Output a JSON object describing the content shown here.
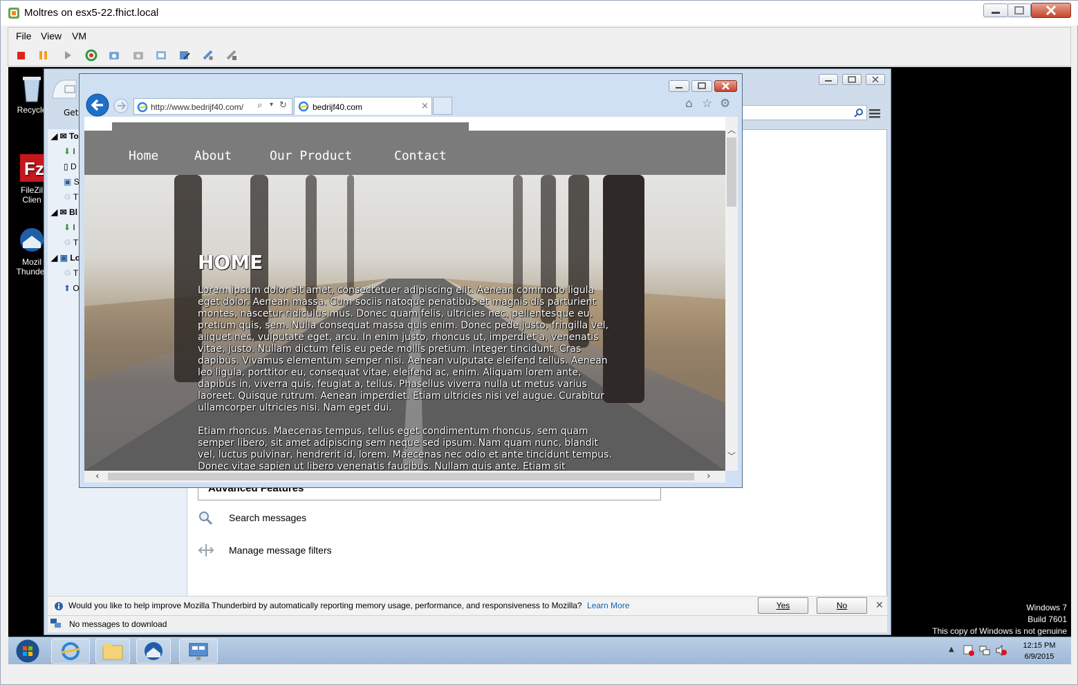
{
  "outer_window": {
    "title": "Moltres on esx5-22.fhict.local",
    "menu": [
      "File",
      "View",
      "VM"
    ]
  },
  "desktop": {
    "icons": [
      {
        "label": "Recycle"
      },
      {
        "label": "FileZil\nClien"
      },
      {
        "label": "Mozil\nThunder"
      }
    ],
    "watermark": [
      "Windows 7",
      "Build 7601",
      "This copy of Windows is not genuine"
    ]
  },
  "thunderbird": {
    "left_rows": [
      "To",
      "I",
      "D",
      "S",
      "T",
      "Bl",
      "I",
      "T",
      "Lo",
      "T",
      "O"
    ],
    "get_label": "Get",
    "advanced_features": "Advanced Features",
    "search_messages": "Search messages",
    "manage_filters": "Manage message filters",
    "notification": "Would you like to help improve Mozilla Thunderbird by automatically reporting memory usage, performance, and responsiveness to Mozilla?",
    "learn_more": "Learn More",
    "yes": "Yes",
    "no": "No",
    "status": "No messages to download"
  },
  "ie": {
    "address": "http://www.bedrijf40.com/",
    "tab_title": "bedrijf40.com",
    "nav": [
      "Home",
      "About",
      "Our Product",
      "Contact"
    ],
    "hero_title": "HOME",
    "para1": "Lorem ipsum dolor sit amet, consectetuer adipiscing elit. Aenean commodo ligula eget dolor. Aenean massa. Cum sociis natoque penatibus et magnis dis parturient montes, nascetur ridiculus mus. Donec quam felis, ultricies nec, pellentesque eu, pretium quis, sem. Nulla consequat massa quis enim. Donec pede justo, fringilla vel, aliquet nec, vulputate eget, arcu. In enim justo, rhoncus ut, imperdiet a, venenatis vitae, justo. Nullam dictum felis eu pede mollis pretium. Integer tincidunt. Cras dapibus. Vivamus elementum semper nisi. Aenean vulputate eleifend tellus. Aenean leo ligula, porttitor eu, consequat vitae, eleifend ac, enim. Aliquam lorem ante, dapibus in, viverra quis, feugiat a, tellus. Phasellus viverra nulla ut metus varius laoreet. Quisque rutrum. Aenean imperdiet. Etiam ultricies nisi vel augue. Curabitur ullamcorper ultricies nisi. Nam eget dui.",
    "para2": "Etiam rhoncus. Maecenas tempus, tellus eget condimentum rhoncus, sem quam semper libero, sit amet adipiscing sem neque sed ipsum. Nam quam nunc, blandit vel, luctus pulvinar, hendrerit id, lorem. Maecenas nec odio et ante tincidunt tempus. Donec vitae sapien ut libero venenatis faucibus. Nullam quis ante. Etiam sit"
  },
  "taskbar": {
    "time": "12:15 PM",
    "date": "6/9/2015"
  },
  "colors": {
    "ie_nav_bg": "#7b7b7b",
    "learn_more": "#0b63b5",
    "desktop_bg": "#000000"
  }
}
